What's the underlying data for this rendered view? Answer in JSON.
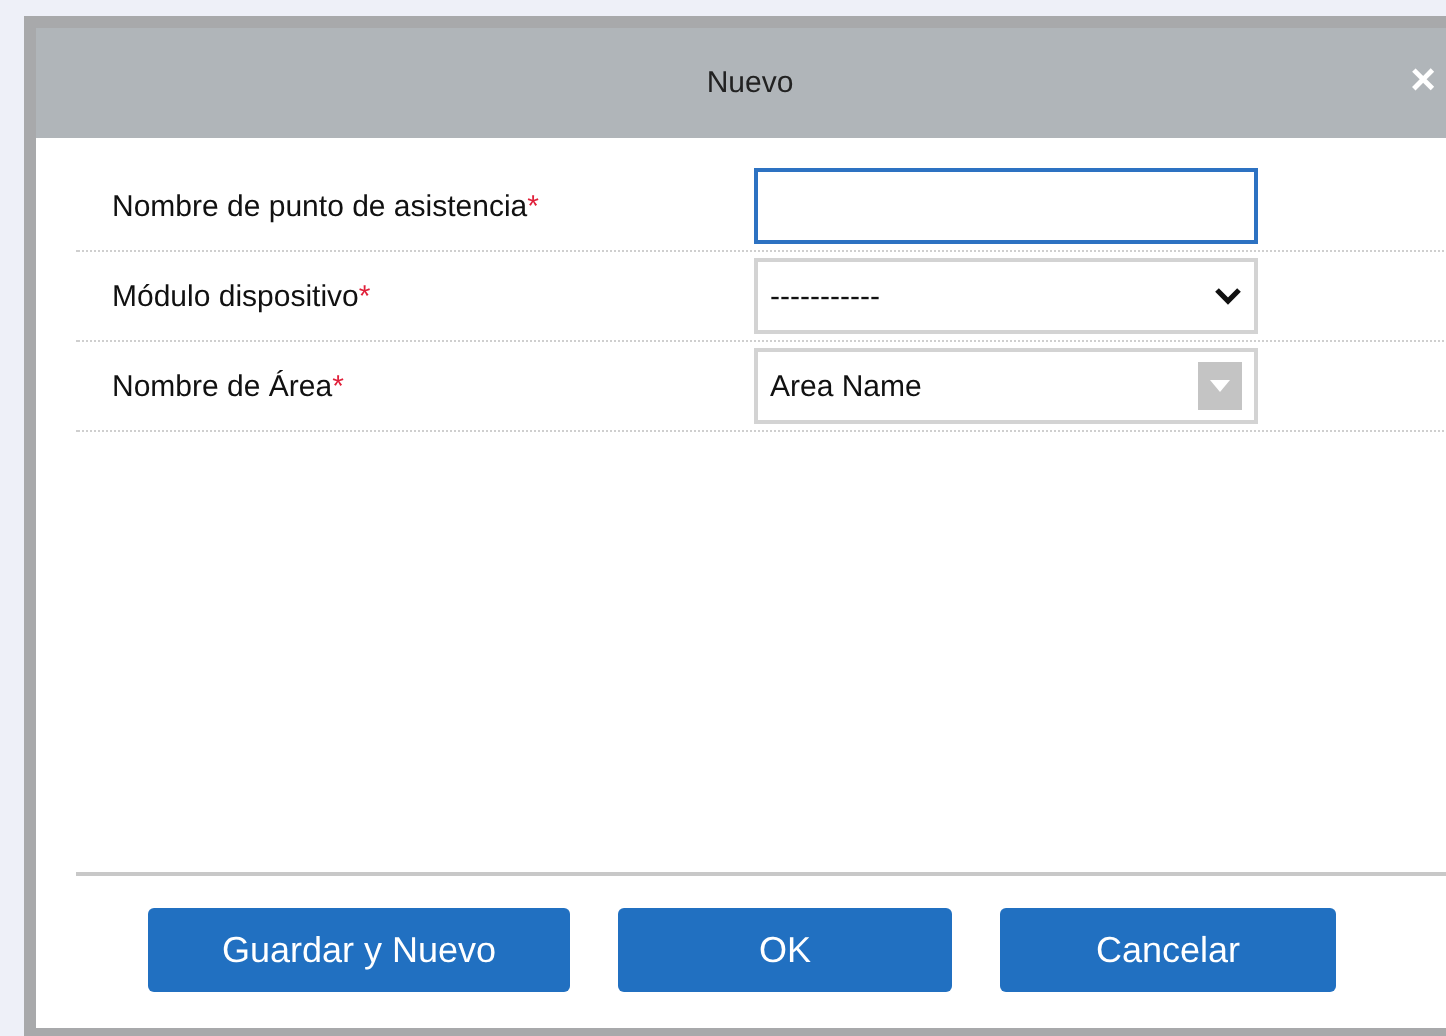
{
  "dialog": {
    "title": "Nuevo",
    "close": "×"
  },
  "fields": [
    {
      "kind": "text",
      "label": "Nombre de punto de asistencia",
      "required_mark": "*",
      "focused": true
    },
    {
      "kind": "select",
      "label": "Módulo dispositivo",
      "required_mark": "*",
      "value": "-----------",
      "focused": false
    },
    {
      "kind": "combo",
      "label": "Nombre de Área",
      "required_mark": "*",
      "value": "Area Name",
      "focused": false
    }
  ],
  "buttons": [
    "Guardar y Nuevo",
    "OK",
    "Cancelar"
  ]
}
